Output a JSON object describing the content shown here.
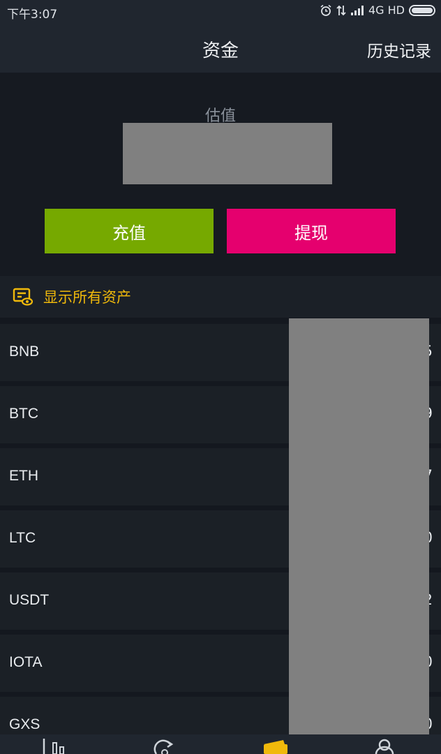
{
  "status_bar": {
    "time": "下午3:07",
    "network": "4G HD"
  },
  "nav": {
    "title": "资金",
    "history_label": "历史记录"
  },
  "summary": {
    "estimate_label": "估值"
  },
  "actions": {
    "deposit_label": "充值",
    "withdraw_label": "提现"
  },
  "filter": {
    "show_all_label": "显示所有资产"
  },
  "assets": [
    {
      "symbol": "BNB",
      "amount_tail": "5"
    },
    {
      "symbol": "BTC",
      "amount_tail": "9"
    },
    {
      "symbol": "ETH",
      "amount_tail": "7"
    },
    {
      "symbol": "LTC",
      "amount_tail": "0"
    },
    {
      "symbol": "USDT",
      "amount_tail": "2"
    },
    {
      "symbol": "IOTA",
      "amount_tail": "0"
    },
    {
      "symbol": "GXS",
      "amount_tail": "0"
    }
  ],
  "colors": {
    "deposit": "#76a900",
    "withdraw": "#e5006e",
    "accent": "#f0b90b"
  },
  "icons": [
    "alarm-icon",
    "data-arrows-icon",
    "signal-icon",
    "battery-icon",
    "wallet-eye-icon",
    "markets-icon",
    "trade-icon",
    "funds-icon",
    "account-icon"
  ]
}
